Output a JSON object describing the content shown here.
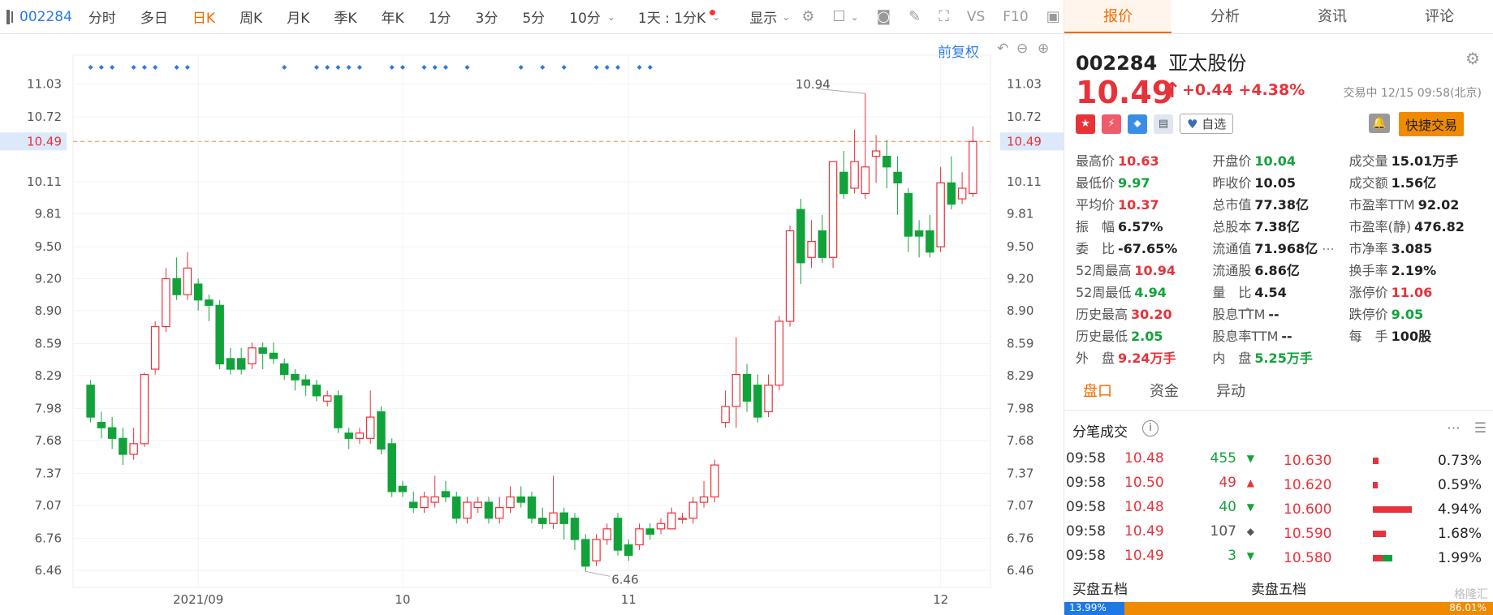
{
  "toolbar": {
    "code": "002284",
    "tabs": [
      "分时",
      "多日",
      "日K",
      "周K",
      "月K",
      "季K",
      "年K",
      "1分",
      "3分",
      "5分",
      "10分"
    ],
    "active_tab": "日K",
    "period": "1天 : 1分K",
    "display": "显示",
    "fuquan": "前复权"
  },
  "chart_data": {
    "type": "candlestick",
    "y_ticks": [
      "11.03",
      "10.72",
      "10.49",
      "10.11",
      "9.81",
      "9.50",
      "9.20",
      "8.90",
      "8.59",
      "8.29",
      "7.98",
      "7.68",
      "7.37",
      "7.07",
      "6.76",
      "6.46"
    ],
    "x_labels": [
      "2021/09",
      "10",
      "11",
      "12"
    ],
    "current_price_line": "10.49",
    "annotation_high": "10.94",
    "annotation_low": "6.46",
    "ylim": [
      6.3,
      11.3
    ],
    "candles": [
      [
        8.2,
        7.9,
        8.25,
        7.85
      ],
      [
        7.85,
        7.8,
        7.95,
        7.7
      ],
      [
        7.8,
        7.7,
        7.9,
        7.6
      ],
      [
        7.7,
        7.55,
        7.8,
        7.45
      ],
      [
        7.55,
        7.65,
        7.8,
        7.5
      ],
      [
        7.65,
        8.3,
        8.32,
        7.62
      ],
      [
        8.35,
        8.75,
        8.8,
        8.3
      ],
      [
        8.75,
        9.2,
        9.3,
        8.7
      ],
      [
        9.2,
        9.05,
        9.4,
        9.0
      ],
      [
        9.05,
        9.3,
        9.45,
        9.0
      ],
      [
        9.15,
        9.0,
        9.2,
        8.9
      ],
      [
        9.0,
        8.95,
        9.05,
        8.8
      ],
      [
        8.95,
        8.4,
        9.0,
        8.35
      ],
      [
        8.45,
        8.35,
        8.55,
        8.3
      ],
      [
        8.45,
        8.35,
        8.55,
        8.3
      ],
      [
        8.4,
        8.55,
        8.6,
        8.35
      ],
      [
        8.55,
        8.5,
        8.6,
        8.35
      ],
      [
        8.5,
        8.45,
        8.6,
        8.4
      ],
      [
        8.4,
        8.3,
        8.45,
        8.25
      ],
      [
        8.3,
        8.25,
        8.35,
        8.15
      ],
      [
        8.25,
        8.2,
        8.3,
        8.1
      ],
      [
        8.2,
        8.1,
        8.25,
        8.05
      ],
      [
        8.05,
        8.1,
        8.15,
        8.0
      ],
      [
        8.1,
        7.8,
        8.15,
        7.75
      ],
      [
        7.75,
        7.7,
        7.8,
        7.6
      ],
      [
        7.7,
        7.75,
        7.8,
        7.65
      ],
      [
        7.7,
        7.9,
        8.15,
        7.65
      ],
      [
        7.95,
        7.6,
        8.0,
        7.55
      ],
      [
        7.65,
        7.2,
        7.7,
        7.15
      ],
      [
        7.25,
        7.2,
        7.3,
        7.15
      ],
      [
        7.1,
        7.05,
        7.2,
        7.0
      ],
      [
        7.05,
        7.15,
        7.2,
        7.0
      ],
      [
        7.1,
        7.15,
        7.35,
        7.05
      ],
      [
        7.2,
        7.15,
        7.3,
        7.1
      ],
      [
        7.15,
        6.95,
        7.2,
        6.9
      ],
      [
        6.95,
        7.1,
        7.15,
        6.9
      ],
      [
        7.05,
        7.1,
        7.15,
        7.0
      ],
      [
        7.1,
        6.95,
        7.15,
        6.9
      ],
      [
        6.95,
        7.05,
        7.15,
        6.9
      ],
      [
        7.05,
        7.15,
        7.25,
        7.0
      ],
      [
        7.15,
        7.1,
        7.25,
        7.05
      ],
      [
        7.15,
        6.95,
        7.2,
        6.9
      ],
      [
        6.95,
        6.9,
        7.05,
        6.85
      ],
      [
        6.9,
        7.0,
        7.35,
        6.85
      ],
      [
        7.0,
        6.9,
        7.05,
        6.75
      ],
      [
        6.95,
        6.75,
        7.0,
        6.65
      ],
      [
        6.75,
        6.5,
        6.8,
        6.45
      ],
      [
        6.55,
        6.75,
        6.8,
        6.5
      ],
      [
        6.75,
        6.85,
        6.9,
        6.7
      ],
      [
        6.95,
        6.65,
        7.0,
        6.6
      ],
      [
        6.7,
        6.6,
        6.75,
        6.55
      ],
      [
        6.7,
        6.85,
        6.9,
        6.65
      ],
      [
        6.85,
        6.8,
        6.9,
        6.75
      ],
      [
        6.85,
        6.9,
        6.95,
        6.8
      ],
      [
        6.85,
        7.0,
        7.05,
        6.85
      ],
      [
        6.95,
        6.95,
        7.0,
        6.9
      ],
      [
        6.95,
        7.1,
        7.15,
        6.9
      ],
      [
        7.1,
        7.15,
        7.3,
        7.05
      ],
      [
        7.15,
        7.45,
        7.5,
        7.1
      ],
      [
        7.85,
        8.0,
        8.15,
        7.8
      ],
      [
        8.0,
        8.3,
        8.65,
        7.8
      ],
      [
        8.3,
        8.05,
        8.4,
        7.95
      ],
      [
        8.2,
        7.9,
        8.3,
        7.85
      ],
      [
        7.95,
        8.2,
        8.3,
        7.9
      ],
      [
        8.2,
        8.8,
        8.85,
        8.15
      ],
      [
        8.8,
        9.65,
        9.7,
        8.75
      ],
      [
        9.85,
        9.35,
        9.95,
        9.15
      ],
      [
        9.4,
        9.55,
        9.75,
        9.3
      ],
      [
        9.65,
        9.4,
        9.8,
        9.35
      ],
      [
        9.4,
        10.3,
        10.3,
        9.3
      ],
      [
        10.2,
        10.0,
        10.4,
        9.95
      ],
      [
        10.05,
        10.3,
        10.6,
        10.0
      ],
      [
        10.0,
        10.25,
        10.94,
        9.95
      ],
      [
        10.35,
        10.4,
        10.55,
        10.1
      ],
      [
        10.35,
        10.25,
        10.5,
        10.05
      ],
      [
        10.2,
        10.1,
        10.35,
        9.8
      ],
      [
        10.0,
        9.6,
        10.05,
        9.45
      ],
      [
        9.65,
        9.6,
        9.75,
        9.4
      ],
      [
        9.65,
        9.45,
        9.8,
        9.4
      ],
      [
        9.5,
        10.1,
        10.25,
        9.45
      ],
      [
        10.1,
        9.9,
        10.35,
        9.85
      ],
      [
        9.95,
        10.05,
        10.2,
        9.9
      ],
      [
        10.0,
        10.49,
        10.63,
        9.97
      ]
    ]
  },
  "quote": {
    "code": "002284",
    "name": "亚太股份",
    "price": "10.49",
    "change": "+0.44 +4.38%",
    "status": "交易中 12/15 09:58(北京)",
    "watch": "自选",
    "fast_trade": "快捷交易",
    "rows": [
      [
        [
          "最高价",
          "10.63",
          "red"
        ],
        [
          "开盘价",
          "10.04",
          "green"
        ],
        [
          "成交量",
          "15.01万手",
          "dark"
        ]
      ],
      [
        [
          "最低价",
          "9.97",
          "green"
        ],
        [
          "昨收价",
          "10.05",
          "dark"
        ],
        [
          "成交额",
          "1.56亿",
          "dark"
        ]
      ],
      [
        [
          "平均价",
          "10.37",
          "red"
        ],
        [
          "总市值",
          "77.38亿",
          "dark"
        ],
        [
          "市盈率TTM",
          "92.02",
          "dark"
        ]
      ],
      [
        [
          "振　幅",
          "6.57%",
          "dark"
        ],
        [
          "总股本",
          "7.38亿",
          "dark"
        ],
        [
          "市盈率(静)",
          "476.82",
          "dark"
        ]
      ],
      [
        [
          "委　比",
          "-67.65%",
          "dark"
        ],
        [
          "流通值",
          "71.968亿",
          "dark"
        ],
        [
          "市净率",
          "3.085",
          "dark"
        ]
      ],
      [
        [
          "52周最高",
          "10.94",
          "red"
        ],
        [
          "流通股",
          "6.86亿",
          "dark"
        ],
        [
          "换手率",
          "2.19%",
          "dark"
        ]
      ],
      [
        [
          "52周最低",
          "4.94",
          "green"
        ],
        [
          "量　比",
          "4.54",
          "dark"
        ],
        [
          "涨停价",
          "11.06",
          "red"
        ]
      ],
      [
        [
          "历史最高",
          "30.20",
          "red"
        ],
        [
          "股息TTM",
          "--",
          "dark"
        ],
        [
          "跌停价",
          "9.05",
          "green"
        ]
      ],
      [
        [
          "历史最低",
          "2.05",
          "green"
        ],
        [
          "股息率TTM",
          "--",
          "dark"
        ],
        [
          "每　手",
          "100股",
          "dark"
        ]
      ],
      [
        [
          "外　盘",
          "9.24万手",
          "red"
        ],
        [
          "内　盘",
          "5.25万手",
          "green"
        ],
        [
          "",
          "",
          " dark"
        ]
      ]
    ]
  },
  "right_tabs": [
    "报价",
    "分析",
    "资讯",
    "评论"
  ],
  "sub_tabs": [
    "盘口",
    "资金",
    "异动"
  ],
  "ticks_title": "分笔成交",
  "ticks": [
    [
      "09:58",
      "10.48",
      "455",
      "green"
    ],
    [
      "09:58",
      "10.50",
      "49",
      "red"
    ],
    [
      "09:58",
      "10.48",
      "40",
      "green"
    ],
    [
      "09:58",
      "10.49",
      "107",
      "gray"
    ],
    [
      "09:58",
      "10.49",
      "3",
      "green"
    ]
  ],
  "depth": [
    [
      "10.630",
      "0.73%",
      0.15,
      "#e8323a"
    ],
    [
      "10.620",
      "0.59%",
      0.12,
      "#e8323a"
    ],
    [
      "10.600",
      "4.94%",
      1.0,
      "#e8323a"
    ],
    [
      "10.590",
      "1.68%",
      0.34,
      "#e8323a"
    ],
    [
      "10.580",
      "1.99%",
      0.4,
      "mix"
    ]
  ],
  "buy_title": "买盘五档",
  "sell_title": "卖盘五档",
  "buy_pct": "13.99%",
  "sell_pct": "86.01%",
  "buy_frac": 0.1399,
  "sell_frac": 0.8601,
  "watermark": "格隆汇"
}
